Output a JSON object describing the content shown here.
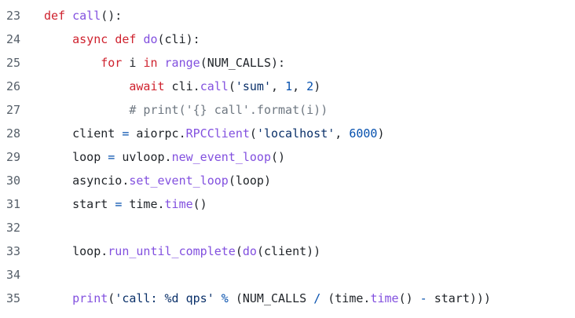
{
  "colors": {
    "text": "#1f2328",
    "line_number": "#57606a",
    "keyword": "#cf222e",
    "function": "#8250df",
    "string": "#0a3069",
    "number": "#0550ae",
    "comment": "#6e7781"
  },
  "lines": [
    {
      "number": "23",
      "tokens": [
        {
          "t": "kw",
          "v": "def"
        },
        {
          "t": "",
          "v": " "
        },
        {
          "t": "fn",
          "v": "call"
        },
        {
          "t": "",
          "v": "():"
        }
      ]
    },
    {
      "number": "24",
      "tokens": [
        {
          "t": "",
          "v": "    "
        },
        {
          "t": "kw",
          "v": "async"
        },
        {
          "t": "",
          "v": " "
        },
        {
          "t": "kw",
          "v": "def"
        },
        {
          "t": "",
          "v": " "
        },
        {
          "t": "fn",
          "v": "do"
        },
        {
          "t": "",
          "v": "(cli):"
        }
      ]
    },
    {
      "number": "25",
      "tokens": [
        {
          "t": "",
          "v": "        "
        },
        {
          "t": "kw",
          "v": "for"
        },
        {
          "t": "",
          "v": " i "
        },
        {
          "t": "kw",
          "v": "in"
        },
        {
          "t": "",
          "v": " "
        },
        {
          "t": "fn",
          "v": "range"
        },
        {
          "t": "",
          "v": "(NUM_CALLS):"
        }
      ]
    },
    {
      "number": "26",
      "tokens": [
        {
          "t": "",
          "v": "            "
        },
        {
          "t": "kw",
          "v": "await"
        },
        {
          "t": "",
          "v": " cli."
        },
        {
          "t": "fn",
          "v": "call"
        },
        {
          "t": "",
          "v": "("
        },
        {
          "t": "str",
          "v": "'sum'"
        },
        {
          "t": "",
          "v": ", "
        },
        {
          "t": "num",
          "v": "1"
        },
        {
          "t": "",
          "v": ", "
        },
        {
          "t": "num",
          "v": "2"
        },
        {
          "t": "",
          "v": ")"
        }
      ]
    },
    {
      "number": "27",
      "tokens": [
        {
          "t": "",
          "v": "            "
        },
        {
          "t": "cmt",
          "v": "# print('{} call'.format(i))"
        }
      ]
    },
    {
      "number": "28",
      "tokens": [
        {
          "t": "",
          "v": "    client "
        },
        {
          "t": "op",
          "v": "="
        },
        {
          "t": "",
          "v": " aiorpc."
        },
        {
          "t": "fn",
          "v": "RPCClient"
        },
        {
          "t": "",
          "v": "("
        },
        {
          "t": "str",
          "v": "'localhost'"
        },
        {
          "t": "",
          "v": ", "
        },
        {
          "t": "num",
          "v": "6000"
        },
        {
          "t": "",
          "v": ")"
        }
      ]
    },
    {
      "number": "29",
      "tokens": [
        {
          "t": "",
          "v": "    loop "
        },
        {
          "t": "op",
          "v": "="
        },
        {
          "t": "",
          "v": " uvloop."
        },
        {
          "t": "fn",
          "v": "new_event_loop"
        },
        {
          "t": "",
          "v": "()"
        }
      ]
    },
    {
      "number": "30",
      "tokens": [
        {
          "t": "",
          "v": "    asyncio."
        },
        {
          "t": "fn",
          "v": "set_event_loop"
        },
        {
          "t": "",
          "v": "(loop)"
        }
      ]
    },
    {
      "number": "31",
      "tokens": [
        {
          "t": "",
          "v": "    start "
        },
        {
          "t": "op",
          "v": "="
        },
        {
          "t": "",
          "v": " time."
        },
        {
          "t": "fn",
          "v": "time"
        },
        {
          "t": "",
          "v": "()"
        }
      ]
    },
    {
      "number": "32",
      "tokens": []
    },
    {
      "number": "33",
      "tokens": [
        {
          "t": "",
          "v": "    loop."
        },
        {
          "t": "fn",
          "v": "run_until_complete"
        },
        {
          "t": "",
          "v": "("
        },
        {
          "t": "fn",
          "v": "do"
        },
        {
          "t": "",
          "v": "(client))"
        }
      ]
    },
    {
      "number": "34",
      "tokens": []
    },
    {
      "number": "35",
      "tokens": [
        {
          "t": "",
          "v": "    "
        },
        {
          "t": "fn",
          "v": "print"
        },
        {
          "t": "",
          "v": "("
        },
        {
          "t": "str",
          "v": "'call: %d qps'"
        },
        {
          "t": "",
          "v": " "
        },
        {
          "t": "op",
          "v": "%"
        },
        {
          "t": "",
          "v": " (NUM_CALLS "
        },
        {
          "t": "op",
          "v": "/"
        },
        {
          "t": "",
          "v": " (time."
        },
        {
          "t": "fn",
          "v": "time"
        },
        {
          "t": "",
          "v": "() "
        },
        {
          "t": "op",
          "v": "-"
        },
        {
          "t": "",
          "v": " start)))"
        }
      ]
    }
  ]
}
